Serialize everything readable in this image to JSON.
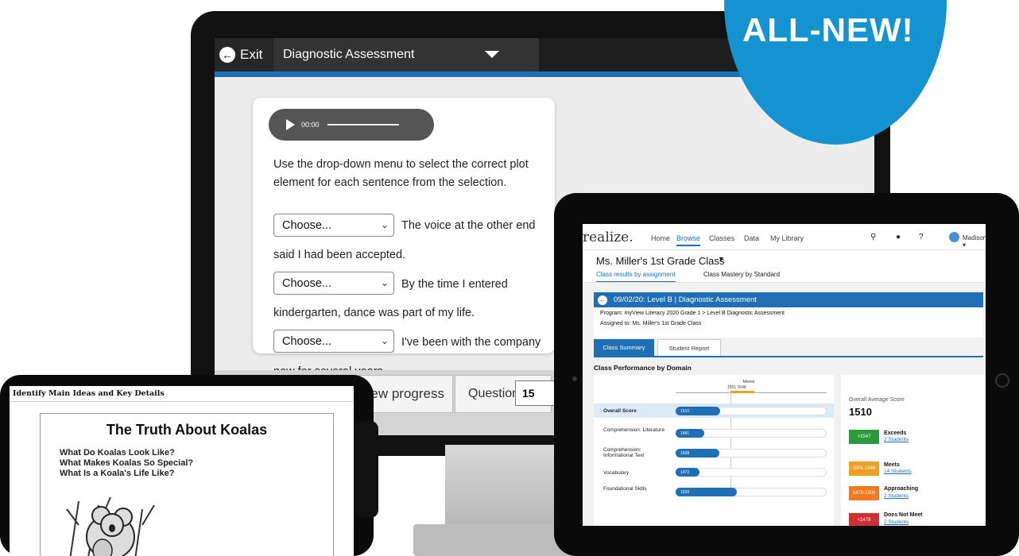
{
  "badge": {
    "text": "ALL-NEW!"
  },
  "desktop": {
    "exit_label": "Exit",
    "assessment_title": "Diagnostic Assessment",
    "audio_time": "00:00",
    "instruction": "Use the drop-down menu to select the correct plot element for each sentence from the selection.",
    "items": [
      {
        "select_value": "Choose...",
        "text_start": "The voice at the other end",
        "text_end": "said I had been accepted."
      },
      {
        "select_value": "Choose...",
        "text_start": "By the time I entered",
        "text_end": "kindergarten, dance was part of my life."
      },
      {
        "select_value": "Choose...",
        "text_start": "I've been with the company",
        "text_end": "now for several years."
      }
    ],
    "view_progress_label": "ew progress",
    "question_label": "Question",
    "question_number": "15"
  },
  "tablet": {
    "brand": "realize.",
    "nav": [
      "Home",
      "Browse",
      "Classes",
      "Data",
      "My Library"
    ],
    "nav_active": "Browse",
    "user_name": "Madison",
    "class_title": "Ms. Miller's 1st Grade Class",
    "subtabs": [
      "Class results by assignment",
      "Class Mastery by Standard"
    ],
    "assignment_header": "09/02/20: Level B | Diagnostic Assessment",
    "program_line": "Program: myView Literacy 2020 Grade 1 > Level B Diagnostic Assessment",
    "assigned_line": "Assigned to: Ms. Miller's 1st Grade Class",
    "summary_tabs": [
      "Class Summary",
      "Student Report"
    ],
    "performance_title": "Class Performance by Domain",
    "meets_label": "Meets",
    "meets_range": "1501    1546",
    "domains": [
      {
        "label": "Overall Score",
        "value": 1510
      },
      {
        "label": "Comprehension: Literature",
        "value": 1481
      },
      {
        "label": "Comprehension: Informational Text",
        "value": 1508
      },
      {
        "label": "Vocabulary",
        "value": 1472
      },
      {
        "label": "Foundational Skills",
        "value": 1539
      }
    ],
    "average_label": "Overall Average Score",
    "average_value": "1510",
    "levels": [
      {
        "range": ">1547",
        "name": "Exceeds",
        "count": "2 Students",
        "color": "#2a9a3a"
      },
      {
        "range": "1501-1546",
        "name": "Meets",
        "count": "14 Students",
        "color": "#f0a020"
      },
      {
        "range": "1479-1500",
        "name": "Approaching",
        "count": "2 Students",
        "color": "#f07a20"
      },
      {
        "range": "<1478",
        "name": "Does Not Meet",
        "count": "2 Students",
        "color": "#d03030"
      }
    ]
  },
  "phone": {
    "header": "Identify Main Ideas and Key Details",
    "title": "The Truth About Koalas",
    "questions": [
      "What Do Koalas Look Like?",
      "What Makes Koalas So Special?",
      "What Is a Koala's Life Like?"
    ]
  }
}
